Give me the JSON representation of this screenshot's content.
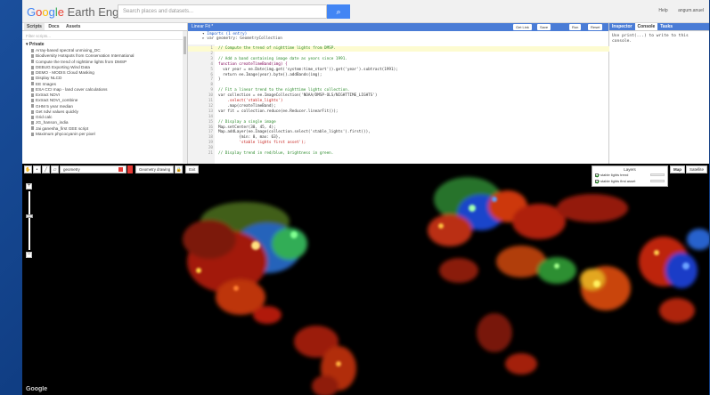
{
  "topbar": {
    "logo_parts": [
      "G",
      "o",
      "o",
      "g",
      "l",
      "e"
    ],
    "logo_rest": " Earth Engine",
    "search_placeholder": "Search places and datasets...",
    "help": "Help",
    "user": "angum.anuel"
  },
  "left_panel": {
    "tabs": [
      "Scripts",
      "Docs",
      "Assets"
    ],
    "filter_placeholder": "Filter scripts...",
    "section": "Private",
    "scripts": [
      "Array-based spectral unmixing_DC",
      "Biodiversity Hotspots from Conservation International",
      "Compute the trend of nighttime lights from DMSP",
      "DEBUG Exporting Wind Data",
      "DEMO - MODIS Cloud Masking",
      "Display NLCD",
      "EE Images",
      "ESA CCI map - land cover calculations",
      "Extract NDVI",
      "Extract NDVI_combine",
      "GHM 5 year median",
      "Get ndvi values quickly",
      "Grid calc",
      "JG_hanson_india",
      "Jai ganesha_first GEE script",
      "Maximum phycocyanin per pixel"
    ]
  },
  "editor": {
    "title": "Linear Fit *",
    "buttons": {
      "get_link": "Get Link",
      "save": "Save",
      "run": "Run",
      "reset": "Reset"
    },
    "imports_header": "Imports (1 entry)",
    "imports_var": "var geometry: GeometryCollection",
    "lines": [
      {
        "n": "1",
        "text": "// Compute the trend of nighttime lights from DMSP.",
        "cls": "c-cm",
        "hl": true
      },
      {
        "n": "2",
        "text": "",
        "cls": "c-def",
        "hl": false
      },
      {
        "n": "3",
        "text": "// Add a band containing image date as years since 1991.",
        "cls": "c-cm",
        "hl": false
      },
      {
        "n": "4",
        "text": "function createTimeBand(img) {",
        "cls": "c-kw",
        "hl": false
      },
      {
        "n": "5",
        "text": "  var year = ee.Date(img.get('system:time_start')).get('year').subtract(1991);",
        "cls": "c-def",
        "hl": false
      },
      {
        "n": "6",
        "text": "  return ee.Image(year).byte().addBands(img);",
        "cls": "c-def",
        "hl": false
      },
      {
        "n": "7",
        "text": "}",
        "cls": "c-def",
        "hl": false
      },
      {
        "n": "8",
        "text": "",
        "cls": "c-def",
        "hl": false
      },
      {
        "n": "9",
        "text": "// Fit a linear trend to the nighttime lights collection.",
        "cls": "c-cm",
        "hl": false
      },
      {
        "n": "10",
        "text": "var collection = ee.ImageCollection('NOAA/DMSP-OLS/NIGHTTIME_LIGHTS')",
        "cls": "c-def",
        "hl": false
      },
      {
        "n": "11",
        "text": "    .select('stable_lights')",
        "cls": "c-str",
        "hl": false
      },
      {
        "n": "12",
        "text": "    .map(createTimeBand);",
        "cls": "c-def",
        "hl": false
      },
      {
        "n": "13",
        "text": "var fit = collection.reduce(ee.Reducer.linearFit());",
        "cls": "c-def",
        "hl": false
      },
      {
        "n": "14",
        "text": "",
        "cls": "c-def",
        "hl": false
      },
      {
        "n": "15",
        "text": "// Display a single image",
        "cls": "c-cm",
        "hl": false
      },
      {
        "n": "16",
        "text": "Map.setCenter(30, 45, 4);",
        "cls": "c-def",
        "hl": false
      },
      {
        "n": "17",
        "text": "Map.addLayer(ee.Image(collection.select('stable_lights').first()),",
        "cls": "c-def",
        "hl": false
      },
      {
        "n": "18",
        "text": "         {min: 0, max: 63},",
        "cls": "c-def",
        "hl": false
      },
      {
        "n": "19",
        "text": "         'stable lights first asset');",
        "cls": "c-str",
        "hl": false
      },
      {
        "n": "20",
        "text": "",
        "cls": "c-def",
        "hl": false
      },
      {
        "n": "21",
        "text": "// Display trend in red/blue, brightness in green.",
        "cls": "c-cm",
        "hl": false
      }
    ]
  },
  "right_panel": {
    "tabs": [
      "Inspector",
      "Console",
      "Tasks"
    ],
    "active_tab": "Console",
    "console_text": "Use print(...) to write to this console."
  },
  "map": {
    "geometry_label": "geometry",
    "draw_label": "Geometry drawing",
    "exit_label": "Exit",
    "layers_title": "Layers",
    "layers": [
      "stable lights trend",
      "stable lights first asset"
    ],
    "map_types": [
      "Map",
      "Satellite"
    ],
    "google_mark": "Google"
  }
}
